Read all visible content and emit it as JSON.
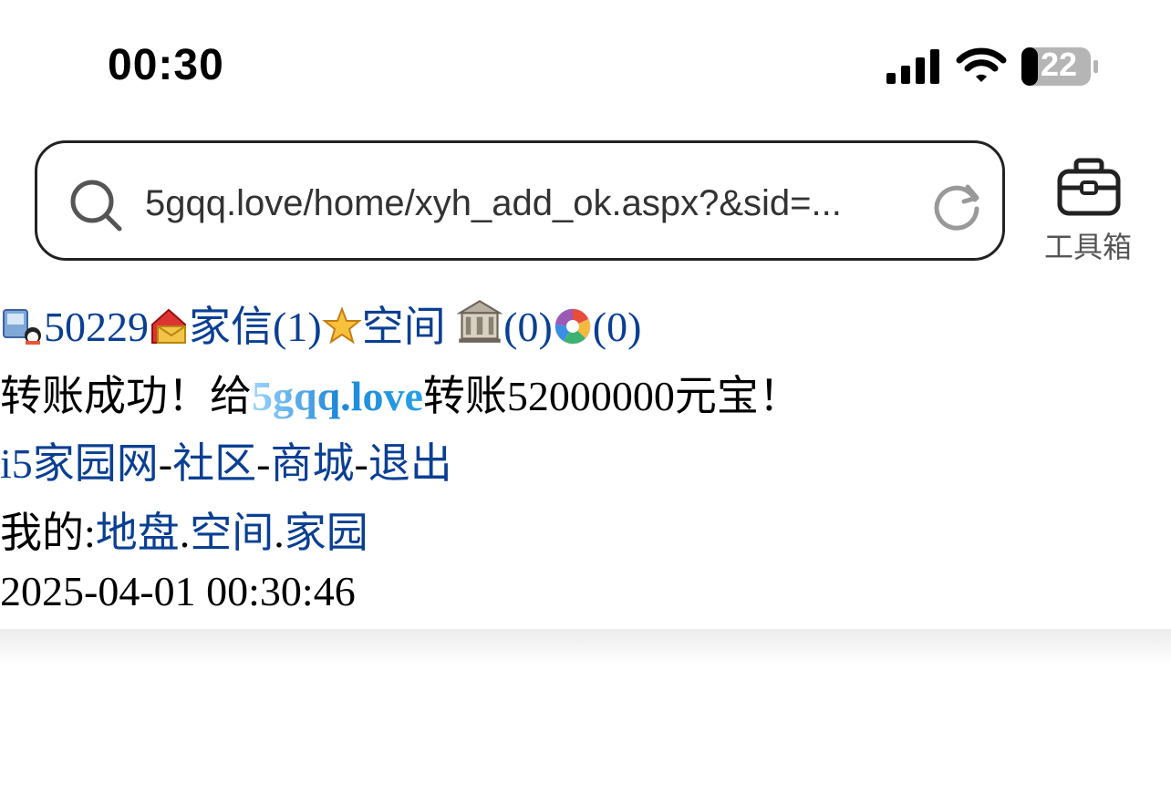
{
  "status": {
    "time": "00:30",
    "battery": "22"
  },
  "browser": {
    "url": "5gqq.love/home/xyh_add_ok.aspx?&sid=...",
    "toolbox_label": "工具箱"
  },
  "nav": {
    "user_id": "50229",
    "mail_label": "家信(1)",
    "space_label": "空间",
    "building_count": "(0)",
    "photo_count": "(0)"
  },
  "message": {
    "prefix": "转账成功！给",
    "recipient": "5gqq.love",
    "suffix": "转账52000000元宝！"
  },
  "links": {
    "home": "i5家园网",
    "sep": "-",
    "community": "社区",
    "mall": "商城",
    "logout": "退出"
  },
  "mine": {
    "label": "我的:",
    "land": "地盘",
    "dot": ".",
    "space": "空间",
    "garden": "家园"
  },
  "timestamp": "2025-04-01 00:30:46"
}
